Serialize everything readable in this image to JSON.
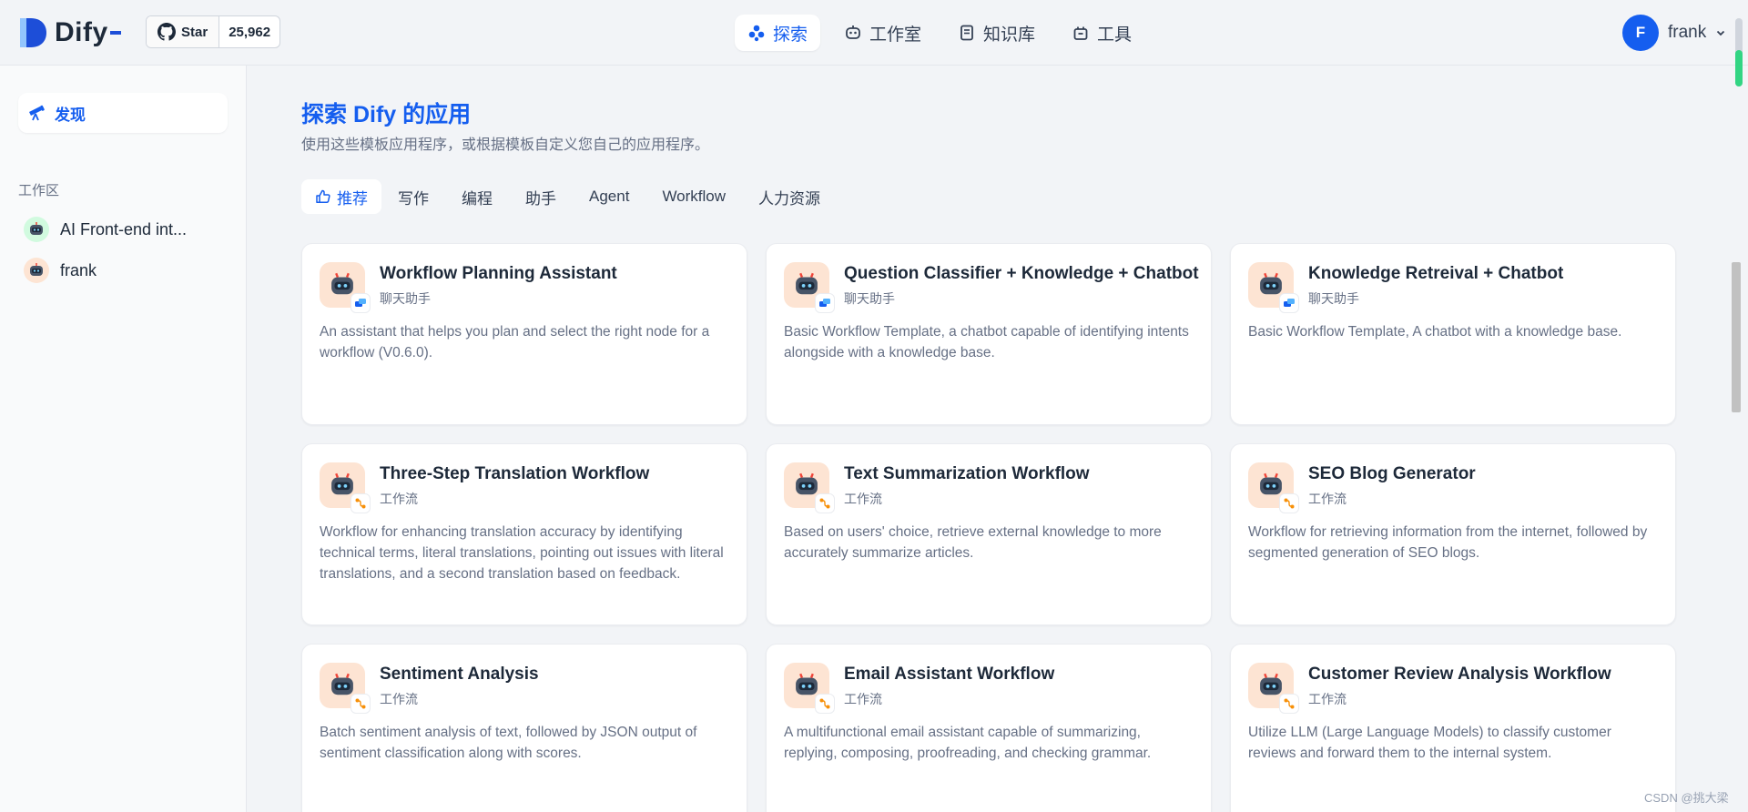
{
  "brand": {
    "name": "Dify",
    "accent": "#155eef"
  },
  "github": {
    "star_label": "Star",
    "count": "25,962"
  },
  "nav": [
    {
      "label": "探索",
      "icon": "explore-icon",
      "active": true
    },
    {
      "label": "工作室",
      "icon": "robot-icon",
      "active": false
    },
    {
      "label": "知识库",
      "icon": "book-icon",
      "active": false
    },
    {
      "label": "工具",
      "icon": "toolbox-icon",
      "active": false
    }
  ],
  "user": {
    "initial": "F",
    "name": "frank"
  },
  "sidebar": {
    "discover_label": "发现",
    "workspace_label": "工作区",
    "items": [
      {
        "label": "AI Front-end int..."
      },
      {
        "label": "frank"
      }
    ]
  },
  "main": {
    "title": "探索 Dify 的应用",
    "subtitle": "使用这些模板应用程序，或根据模板自定义您自己的应用程序。",
    "tabs": [
      {
        "label": "推荐",
        "active": true
      },
      {
        "label": "写作"
      },
      {
        "label": "编程"
      },
      {
        "label": "助手"
      },
      {
        "label": "Agent"
      },
      {
        "label": "Workflow"
      },
      {
        "label": "人力资源"
      }
    ],
    "cards": [
      {
        "title": "Workflow Planning Assistant",
        "type": "聊天助手",
        "kind": "chat",
        "desc": "An assistant that helps you plan and select the right node for a workflow (V0.6.0)."
      },
      {
        "title": "Question Classifier + Knowledge + Chatbot",
        "type": "聊天助手",
        "kind": "chat",
        "desc": "Basic Workflow Template, a chatbot capable of identifying intents alongside with a knowledge base."
      },
      {
        "title": "Knowledge Retreival + Chatbot",
        "type": "聊天助手",
        "kind": "chat",
        "desc": "Basic Workflow Template, A chatbot with a knowledge base."
      },
      {
        "title": "Three-Step Translation Workflow",
        "type": "工作流",
        "kind": "workflow",
        "desc": "Workflow for enhancing translation accuracy by identifying technical terms, literal translations, pointing out issues with literal translations, and a second translation based on feedback."
      },
      {
        "title": "Text Summarization Workflow",
        "type": "工作流",
        "kind": "workflow",
        "desc": "Based on users' choice, retrieve external knowledge to more accurately summarize articles."
      },
      {
        "title": "SEO Blog Generator",
        "type": "工作流",
        "kind": "workflow",
        "desc": "Workflow for retrieving information from the internet, followed by segmented generation of SEO blogs."
      },
      {
        "title": "Sentiment Analysis",
        "type": "工作流",
        "kind": "workflow",
        "desc": "Batch sentiment analysis of text, followed by JSON output of sentiment classification along with scores."
      },
      {
        "title": "Email Assistant Workflow",
        "type": "工作流",
        "kind": "workflow",
        "desc": "A multifunctional email assistant capable of summarizing, replying, composing, proofreading, and checking grammar."
      },
      {
        "title": "Customer Review Analysis Workflow",
        "type": "工作流",
        "kind": "workflow",
        "desc": "Utilize LLM (Large Language Models) to classify customer reviews and forward them to the internal system."
      }
    ]
  },
  "watermark": "CSDN @挑大梁"
}
